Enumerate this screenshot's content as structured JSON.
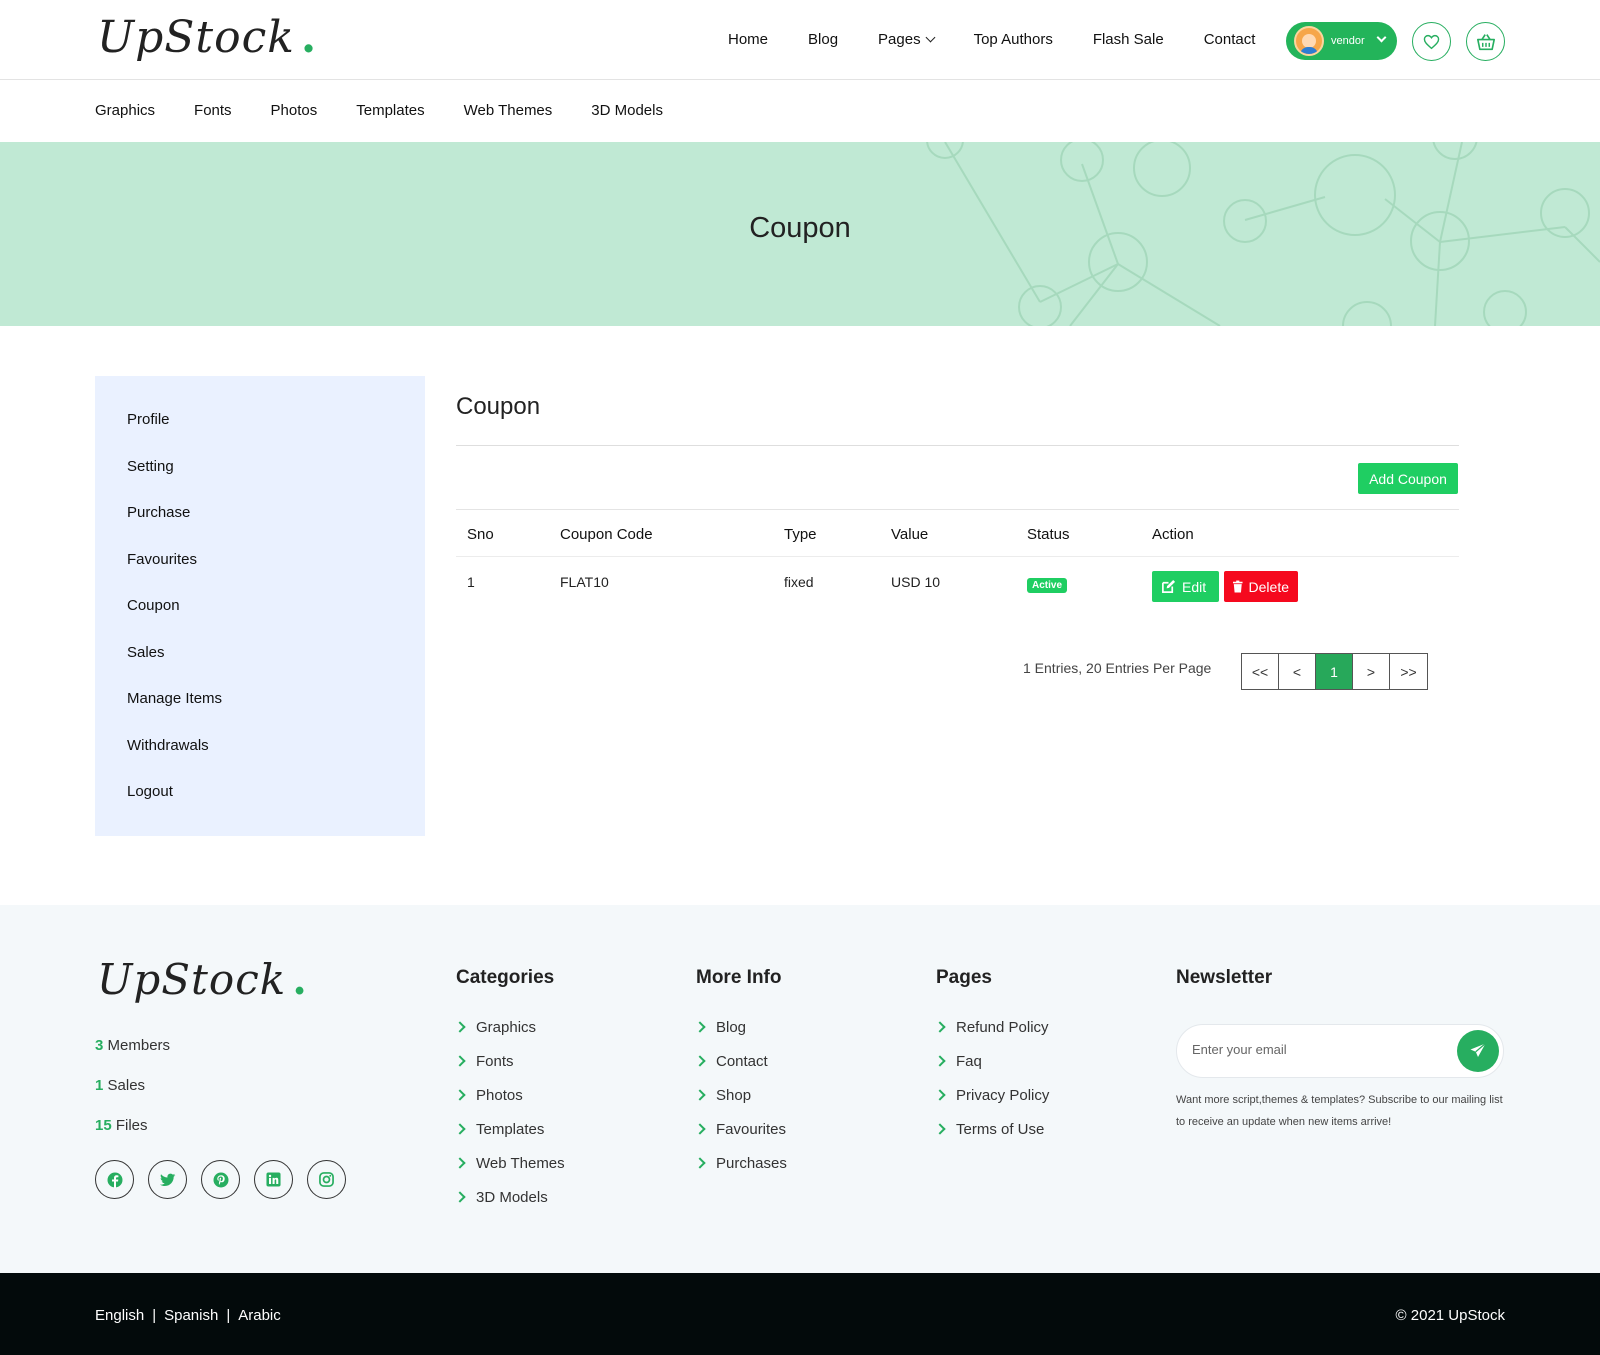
{
  "brand": {
    "name": "UpStock",
    "dot": "."
  },
  "nav": {
    "items": [
      {
        "label": "Home"
      },
      {
        "label": "Blog"
      },
      {
        "label": "Pages"
      },
      {
        "label": "Top Authors"
      },
      {
        "label": "Flash Sale"
      },
      {
        "label": "Contact"
      }
    ],
    "user": {
      "label": "vendor"
    }
  },
  "categories": [
    "Graphics",
    "Fonts",
    "Photos",
    "Templates",
    "Web Themes",
    "3D Models"
  ],
  "banner": {
    "title": "Coupon"
  },
  "sidebar": {
    "items": [
      "Profile",
      "Setting",
      "Purchase",
      "Favourites",
      "Coupon",
      "Sales",
      "Manage Items",
      "Withdrawals",
      "Logout"
    ]
  },
  "main": {
    "title": "Coupon",
    "add_button": "Add Coupon",
    "table": {
      "headers": [
        "Sno",
        "Coupon Code",
        "Type",
        "Value",
        "Status",
        "Action"
      ],
      "rows": [
        {
          "sno": "1",
          "code": "FLAT10",
          "type": "fixed",
          "value": "USD 10",
          "status": "Active",
          "edit": "Edit",
          "delete": "Delete"
        }
      ]
    },
    "pagination": {
      "summary": "1 Entries, 20 Entries Per Page",
      "first": "<<",
      "prev": "<",
      "current": "1",
      "next": ">",
      "last": ">>"
    }
  },
  "footer": {
    "stats": [
      {
        "count": "3",
        "label": "Members"
      },
      {
        "count": "1",
        "label": "Sales"
      },
      {
        "count": "15",
        "label": "Files"
      }
    ],
    "socials": [
      "facebook-icon",
      "twitter-icon",
      "pinterest-icon",
      "linkedin-icon",
      "instagram-icon"
    ],
    "columns": {
      "categories": {
        "title": "Categories",
        "links": [
          "Graphics",
          "Fonts",
          "Photos",
          "Templates",
          "Web Themes",
          "3D Models"
        ]
      },
      "more_info": {
        "title": "More Info",
        "links": [
          "Blog",
          "Contact",
          "Shop",
          "Favourites",
          "Purchases"
        ]
      },
      "pages": {
        "title": "Pages",
        "links": [
          "Refund Policy",
          "Faq",
          "Privacy Policy",
          "Terms of Use"
        ]
      }
    },
    "newsletter": {
      "title": "Newsletter",
      "placeholder": "Enter your email",
      "note": "Want more script,themes & templates? Subscribe to our mailing list to receive an update when new items arrive!"
    },
    "languages": [
      "English",
      "Spanish",
      "Arabic"
    ],
    "copyright": "© 2021 UpStock"
  },
  "colors": {
    "accent": "#27ae60",
    "button_green": "#1fce62",
    "danger": "#f5091e",
    "banner": "#c0e9d4",
    "sidebar": "#eaf1ff",
    "bottom": "#030a0b"
  }
}
